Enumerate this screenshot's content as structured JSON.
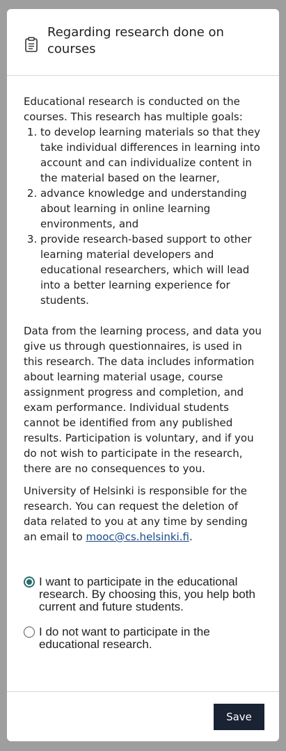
{
  "modal": {
    "title": "Regarding research done on courses",
    "icon": "clipboard-icon"
  },
  "content": {
    "intro": "Educational research is conducted on the courses. This research has multiple goals:",
    "goals": [
      "to develop learning materials so that they take individual differences in learning into account and can individualize content in the material based on the learner,",
      "advance knowledge and understanding about learning in online learning environments, and",
      "provide research-based support to other learning material developers and educational researchers, which will lead into a better learning experience for students."
    ],
    "data_paragraph": "Data from the learning process, and data you give us through questionnaires, is used in this research. The data includes information about learning material usage, course assignment progress and completion, and exam performance. Individual students cannot be identified from any published results. Participation is voluntary, and if you do not wish to participate in the research, there are no consequences to you.",
    "responsibility_text": "University of Helsinki is responsible for the research. You can request the deletion of data related to you at any time by sending an email to ",
    "email": "mooc@cs.helsinki.fi",
    "period": "."
  },
  "options": {
    "participate": "I want to participate in the educational research. By choosing this, you help both current and future students.",
    "decline": "I do not want to participate in the educational research.",
    "selected": "participate"
  },
  "footer": {
    "save_label": "Save"
  },
  "colors": {
    "backdrop": "#9e9e9e",
    "button": "#1a2333",
    "radio_accent": "#2a6b6b",
    "link": "#1a4a8a"
  }
}
